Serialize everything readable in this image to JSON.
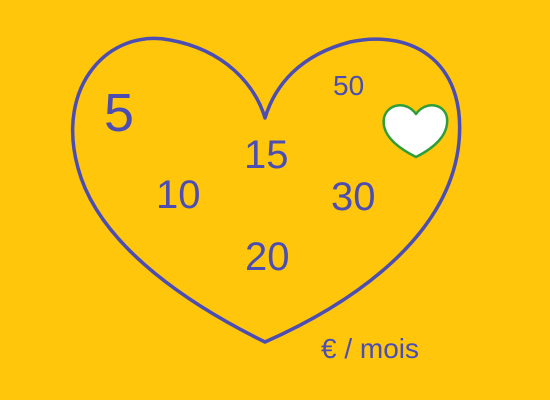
{
  "colors": {
    "background": "#FFC60B",
    "heart_outline": "#4B4DB3",
    "text": "#4B4DB3",
    "small_heart_fill": "#FFFFFF",
    "small_heart_outline": "#2E9E3A"
  },
  "amounts": [
    {
      "value": "5"
    },
    {
      "value": "50"
    },
    {
      "value": "15"
    },
    {
      "value": "10"
    },
    {
      "value": "30"
    },
    {
      "value": "20"
    }
  ],
  "unit_label": "€ / mois",
  "icons": {
    "big_heart": "heart-outline-icon",
    "small_heart": "heart-icon"
  }
}
